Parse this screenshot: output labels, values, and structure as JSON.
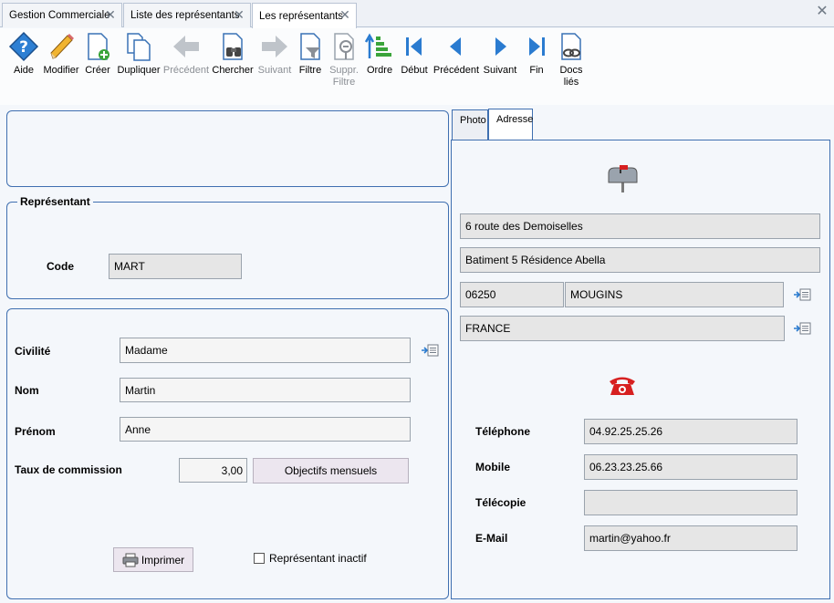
{
  "tabs": [
    {
      "label": "Gestion Commerciale"
    },
    {
      "label": "Liste des représentants"
    },
    {
      "label": "Les représentants",
      "active": true
    }
  ],
  "toolbar": [
    {
      "label": "Aide",
      "icon": "help-icon"
    },
    {
      "label": "Modifier",
      "icon": "pencil-icon"
    },
    {
      "label": "Créer",
      "icon": "new-document-icon"
    },
    {
      "label": "Dupliquer",
      "icon": "duplicate-icon"
    },
    {
      "label": "Précédent",
      "icon": "arrow-left-icon",
      "disabled": true
    },
    {
      "label": "Chercher",
      "icon": "binoculars-icon"
    },
    {
      "label": "Suivant",
      "icon": "arrow-right-icon",
      "disabled": true
    },
    {
      "label": "Filtre",
      "icon": "filter-icon"
    },
    {
      "label": "Suppr.\nFiltre",
      "icon": "remove-filter-icon",
      "disabled": true
    },
    {
      "label": "Ordre",
      "icon": "sort-order-icon"
    },
    {
      "label": "Début",
      "icon": "first-record-icon"
    },
    {
      "label": "Précédent",
      "icon": "previous-record-icon"
    },
    {
      "label": "Suivant",
      "icon": "next-record-icon"
    },
    {
      "label": "Fin",
      "icon": "last-record-icon"
    },
    {
      "label": "Docs\nliés",
      "icon": "linked-docs-icon"
    }
  ],
  "representant": {
    "legend": "Représentant",
    "code_label": "Code",
    "code_value": "MART"
  },
  "details": {
    "civilite_label": "Civilité",
    "civilite_value": "Madame",
    "nom_label": "Nom",
    "nom_value": "Martin",
    "prenom_label": "Prénom",
    "prenom_value": "Anne",
    "taux_label": "Taux de commission",
    "taux_value": "3,00",
    "objectifs_button": "Objectifs mensuels",
    "print_button": "Imprimer",
    "inactive_label": "Représentant inactif",
    "inactive_checked": false
  },
  "right_tabs": [
    {
      "label": "Photo"
    },
    {
      "label": "Adresse",
      "active": true
    }
  ],
  "address": {
    "line1": "6 route des Demoiselles",
    "line2": "Batiment 5 Résidence Abella",
    "postcode": "06250",
    "city": "MOUGINS",
    "country": "FRANCE"
  },
  "contact": {
    "telephone_label": "Téléphone",
    "telephone_value": "04.92.25.25.26",
    "mobile_label": "Mobile",
    "mobile_value": "06.23.23.25.66",
    "telecopie_label": "Télécopie",
    "telecopie_value": "",
    "email_label": "E-Mail",
    "email_value": "martin@yahoo.fr"
  },
  "colors": {
    "panel_border": "#3f6fb0",
    "accent_blue": "#2a7bd0",
    "phone_red": "#d72020"
  }
}
